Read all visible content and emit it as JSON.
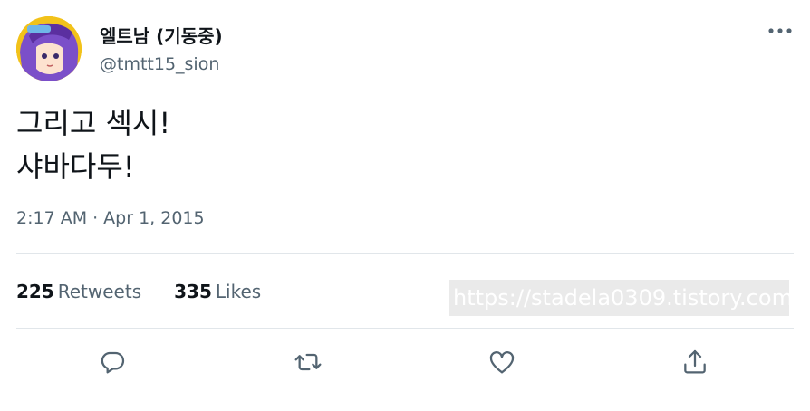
{
  "author": {
    "display_name": "엘트남 (기동중)",
    "handle": "@tmtt15_sion",
    "avatar_icon": "avatar-image"
  },
  "tweet": {
    "lines": [
      "그리고 섹시!",
      "샤바다두!"
    ]
  },
  "meta": {
    "time": "2:17 AM",
    "separator": "·",
    "date": "Apr 1, 2015"
  },
  "stats": {
    "retweets_count": "225",
    "retweets_label": "Retweets",
    "likes_count": "335",
    "likes_label": "Likes"
  },
  "watermark": {
    "text": "https://stadela0309.tistory.com"
  },
  "actions": {
    "reply_icon": "reply-icon",
    "retweet_icon": "retweet-icon",
    "like_icon": "heart-icon",
    "share_icon": "share-icon"
  },
  "colors": {
    "primary_text": "#0f1419",
    "secondary_text": "#536471",
    "divider": "#e1e6ea",
    "watermark_bg": "#eaeaea"
  }
}
